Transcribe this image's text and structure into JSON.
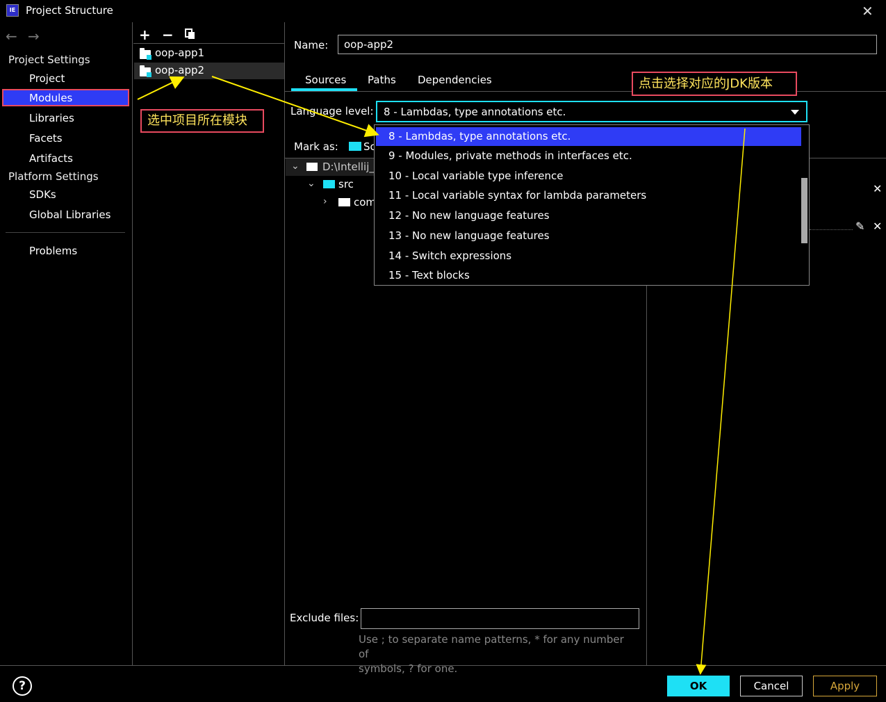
{
  "window": {
    "title": "Project Structure"
  },
  "nav": {
    "project_settings": "Project Settings",
    "items_project": [
      "Project",
      "Modules",
      "Libraries",
      "Facets",
      "Artifacts"
    ],
    "platform_settings": "Platform Settings",
    "items_platform": [
      "SDKs",
      "Global Libraries"
    ],
    "problems": "Problems"
  },
  "modules": [
    "oop-app1",
    "oop-app2"
  ],
  "detail": {
    "name_label": "Name:",
    "name_value": "oop-app2",
    "tabs": [
      "Sources",
      "Paths",
      "Dependencies"
    ],
    "language_label": "Language level:",
    "language_value": "8 - Lambdas, type annotations etc.",
    "language_options": [
      "8 - Lambdas, type annotations etc.",
      "9 - Modules, private methods in interfaces etc.",
      "10 - Local variable type inference",
      "11 - Local variable syntax for lambda parameters",
      "12 - No new language features",
      "13 - No new language features",
      "14 - Switch expressions",
      "15 - Text blocks"
    ],
    "mark_as_label": "Mark as:",
    "mark_as_partial": "Sc",
    "tree": {
      "root": "D:\\Intellij_",
      "src": "src",
      "com": "com"
    },
    "exclude_label": "Exclude files:",
    "exclude_value": "",
    "exclude_hint_1": "Use ; to separate name patterns, * for any number of",
    "exclude_hint_2": "symbols, ? for one."
  },
  "annotations": {
    "select_module": "选中项目所在模块",
    "select_jdk": "点击选择对应的JDK版本"
  },
  "buttons": {
    "ok": "OK",
    "cancel": "Cancel",
    "apply": "Apply",
    "help": "?"
  },
  "colors": {
    "accent": "#1ee0f5",
    "selection": "#2f3cf5",
    "annotation_border": "#e84a5f",
    "annotation_text": "#ffe45c",
    "apply": "#d8a83a"
  }
}
